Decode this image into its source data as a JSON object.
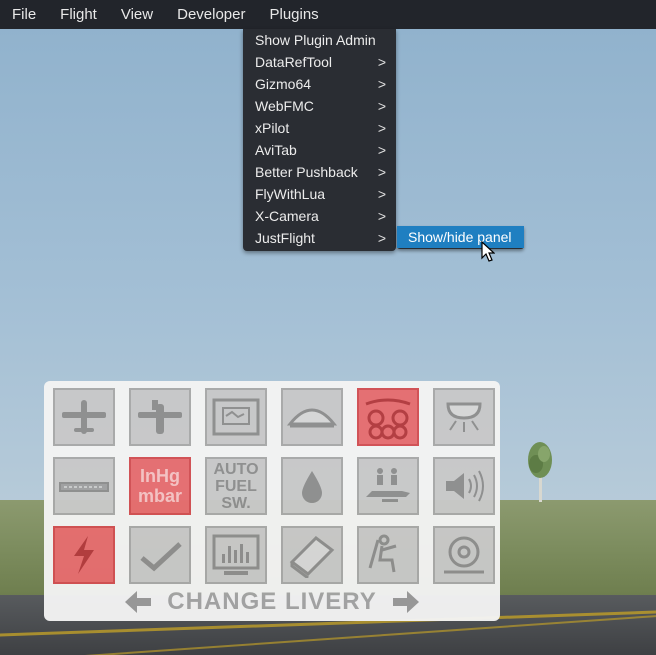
{
  "menubar": {
    "items": [
      "File",
      "Flight",
      "View",
      "Developer",
      "Plugins"
    ],
    "active": "Plugins"
  },
  "plugins_menu": {
    "items": [
      {
        "label": "Show Plugin Admin",
        "submenu": false
      },
      {
        "label": "DataRefTool",
        "submenu": true
      },
      {
        "label": "Gizmo64",
        "submenu": true
      },
      {
        "label": "WebFMC",
        "submenu": true
      },
      {
        "label": "xPilot",
        "submenu": true
      },
      {
        "label": "AviTab",
        "submenu": true
      },
      {
        "label": "Better Pushback",
        "submenu": true
      },
      {
        "label": "FlyWithLua",
        "submenu": true
      },
      {
        "label": "X-Camera",
        "submenu": true
      },
      {
        "label": "JustFlight",
        "submenu": true
      }
    ],
    "arrow_glyph": ">"
  },
  "justflight_submenu": {
    "items": [
      "Show/hide panel"
    ]
  },
  "aircraft_panel": {
    "tiles": [
      {
        "icon": "airplane-top-icon",
        "active": false
      },
      {
        "icon": "airplane-tail-icon",
        "active": false
      },
      {
        "icon": "instrument-panel-icon",
        "active": false
      },
      {
        "icon": "canopy-icon",
        "active": false
      },
      {
        "icon": "wheels-icon",
        "active": true
      },
      {
        "icon": "light-icon",
        "active": false
      },
      {
        "icon": "strip-icon",
        "active": false
      },
      {
        "icon": "units-toggle-icon",
        "active": true,
        "text_top": "InHg",
        "text_bottom": "mbar"
      },
      {
        "icon": "auto-fuel-icon",
        "active": false,
        "text_lines": [
          "AUTO",
          "FUEL",
          "SW."
        ]
      },
      {
        "icon": "fuel-drop-icon",
        "active": false
      },
      {
        "icon": "passengers-icon",
        "active": false
      },
      {
        "icon": "speaker-icon",
        "active": false
      },
      {
        "icon": "electric-icon",
        "active": true
      },
      {
        "icon": "checklist-icon",
        "active": false
      },
      {
        "icon": "monitor-icon",
        "active": false
      },
      {
        "icon": "manual-icon",
        "active": false
      },
      {
        "icon": "pilot-seat-icon",
        "active": false
      },
      {
        "icon": "wheel-chock-icon",
        "active": false
      }
    ],
    "livery_label": "CHANGE LIVERY"
  },
  "colors": {
    "menubar_bg": "#22252b",
    "menu_bg": "#2a2d33",
    "highlight": "#1f7fc1",
    "tile_active": "#e76d6f"
  }
}
